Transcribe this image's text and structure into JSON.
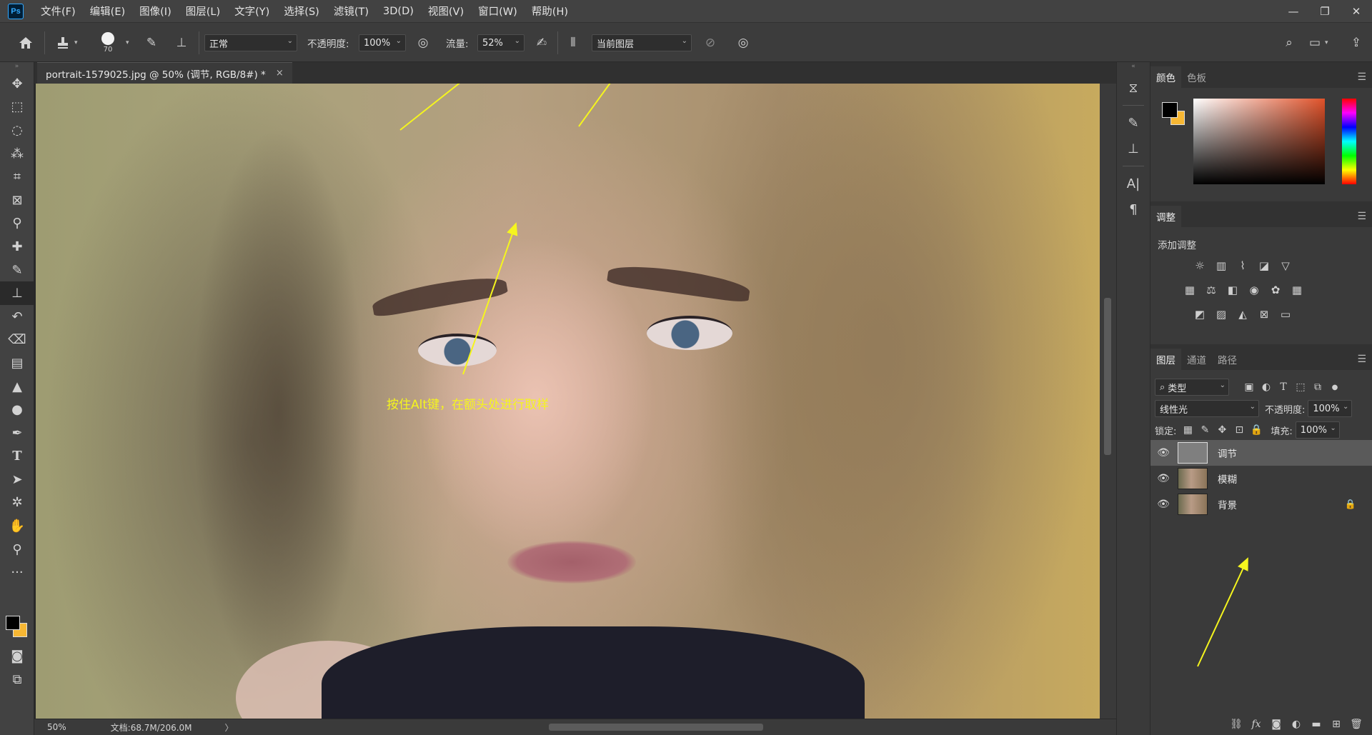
{
  "app": {
    "logo": "Ps"
  },
  "menu": [
    "文件(F)",
    "编辑(E)",
    "图像(I)",
    "图层(L)",
    "文字(Y)",
    "选择(S)",
    "滤镜(T)",
    "3D(D)",
    "视图(V)",
    "窗口(W)",
    "帮助(H)"
  ],
  "window_controls": {
    "minimize": "—",
    "restore": "❐",
    "close": "✕"
  },
  "options": {
    "brush_size": "70",
    "mode": "正常",
    "opacity_label": "不透明度:",
    "opacity_value": "100%",
    "flow_label": "流量:",
    "flow_value": "52%",
    "sample": "当前图层"
  },
  "document": {
    "tab_title": "portrait-1579025.jpg @ 50% (调节, RGB/8#) *",
    "tab_close": "×",
    "caption": "按住Alt键，在额头处进行取样"
  },
  "status": {
    "zoom": "50%",
    "doc_info": "文档:68.7M/206.0M",
    "arrow": "〉"
  },
  "tools": [
    "move-icon",
    "marquee-icon",
    "lasso-icon",
    "quick-select-icon",
    "crop-icon",
    "frame-icon",
    "eyedropper-icon",
    "healing-brush-icon",
    "brush-icon",
    "clone-stamp-icon",
    "history-brush-icon",
    "eraser-icon",
    "gradient-icon",
    "blur-icon",
    "dodge-icon",
    "pen-icon",
    "type-icon",
    "path-select-icon",
    "shape-icon",
    "hand-icon",
    "zoom-icon",
    "more-icon"
  ],
  "colors": {
    "foreground": "#000000",
    "background": "#f7b733",
    "annotation": "#f5f51e"
  },
  "panels": {
    "color_tabs": [
      "颜色",
      "色板"
    ],
    "adjust_tab": "调整",
    "adjust_title": "添加调整",
    "layers_tabs": [
      "图层",
      "通道",
      "路径"
    ],
    "filter_kind": "类型",
    "blend_mode": "线性光",
    "opacity_label": "不透明度:",
    "opacity_value": "100%",
    "lock_label": "锁定:",
    "fill_label": "填充:",
    "fill_value": "100%",
    "footer_fx": "fx"
  },
  "layers": [
    {
      "name": "调节",
      "selected": true,
      "locked": false
    },
    {
      "name": "模糊",
      "selected": false,
      "locked": false
    },
    {
      "name": "背景",
      "selected": false,
      "locked": true
    }
  ]
}
